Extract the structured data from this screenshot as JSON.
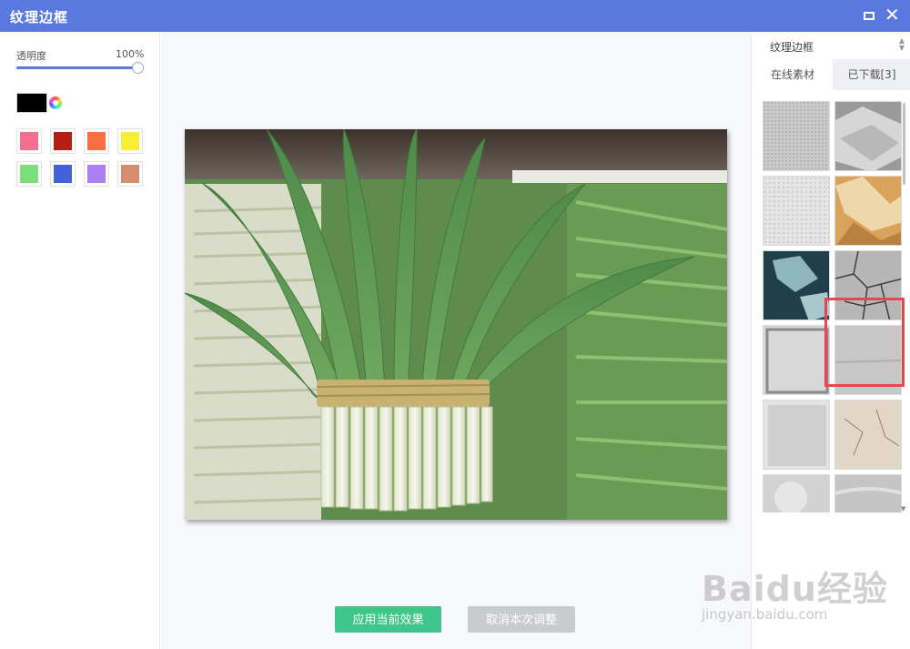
{
  "window": {
    "title": "纹理边框",
    "maximize_icon": "maximize-icon",
    "close_icon": "close-icon",
    "close_glyph": "✕"
  },
  "left_panel": {
    "opacity_label": "透明度",
    "opacity_value": "100%",
    "opacity_level": 1.0,
    "current_color": "#000000",
    "swatches": [
      "#f5708e",
      "#b41d10",
      "#fb6f45",
      "#f8ee35",
      "#7ee07a",
      "#3f63d6",
      "#ac80ef",
      "#d58c71"
    ]
  },
  "preview": {
    "description_icon": "chives-photo"
  },
  "buttons": {
    "apply": "应用当前效果",
    "cancel": "取消本次调整"
  },
  "right_panel": {
    "select_value": "纹理边框",
    "tabs": [
      {
        "label": "在线素材",
        "active": true
      },
      {
        "label": "已下载[3]",
        "active": false
      }
    ],
    "textures": [
      "grid-grey",
      "crumpled-grey",
      "dotted-light",
      "marble-orange",
      "stone-teal",
      "cracked-grey",
      "paper-grey",
      "plain-grey",
      "grunge-light",
      "parchment-beige",
      "cloudy-grey",
      "wave-grey"
    ],
    "selected_texture": "cracked-grey"
  },
  "watermark": {
    "brand": "Baidu经验",
    "url": "jingyan.baidu.com"
  }
}
